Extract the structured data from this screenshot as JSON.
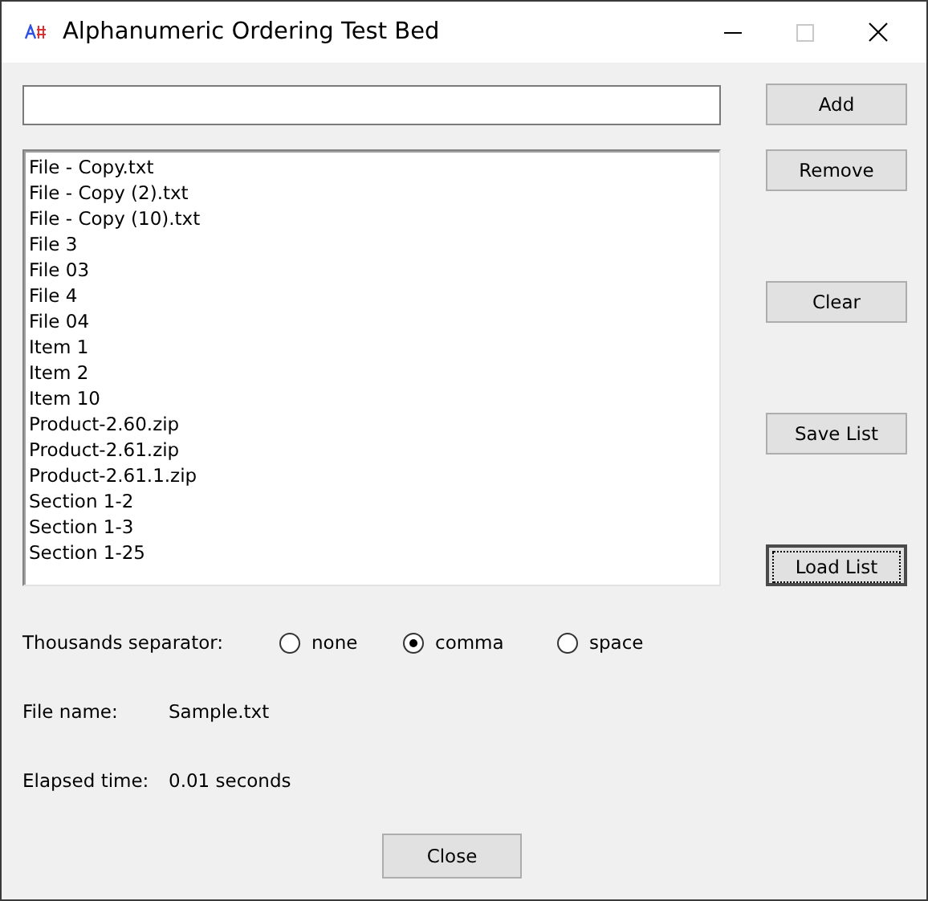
{
  "window": {
    "title": "Alphanumeric Ordering Test Bed"
  },
  "list": {
    "items": [
      "File - Copy.txt",
      "File - Copy (2).txt",
      "File - Copy (10).txt",
      "File 3",
      "File 03",
      "File 4",
      "File 04",
      "Item 1",
      "Item 2",
      "Item 10",
      "Product-2.60.zip",
      "Product-2.61.zip",
      "Product-2.61.1.zip",
      "Section 1-2",
      "Section 1-3",
      "Section 1-25"
    ]
  },
  "buttons": [
    {
      "label": "Add",
      "focused": false
    },
    {
      "label": "Remove",
      "focused": false
    },
    {
      "label": "Clear",
      "focused": false
    },
    {
      "label": "Save List",
      "focused": false
    },
    {
      "label": "Load List",
      "focused": true
    }
  ],
  "separator": {
    "label": "Thousands separator:",
    "options": [
      {
        "label": "none",
        "selected": false
      },
      {
        "label": "comma",
        "selected": true
      },
      {
        "label": "space",
        "selected": false
      }
    ]
  },
  "file_name": {
    "label": "File name:",
    "value": "Sample.txt"
  },
  "elapsed": {
    "label": "Elapsed time:",
    "value": "0.01 seconds"
  },
  "close_button": {
    "label": "Close"
  }
}
